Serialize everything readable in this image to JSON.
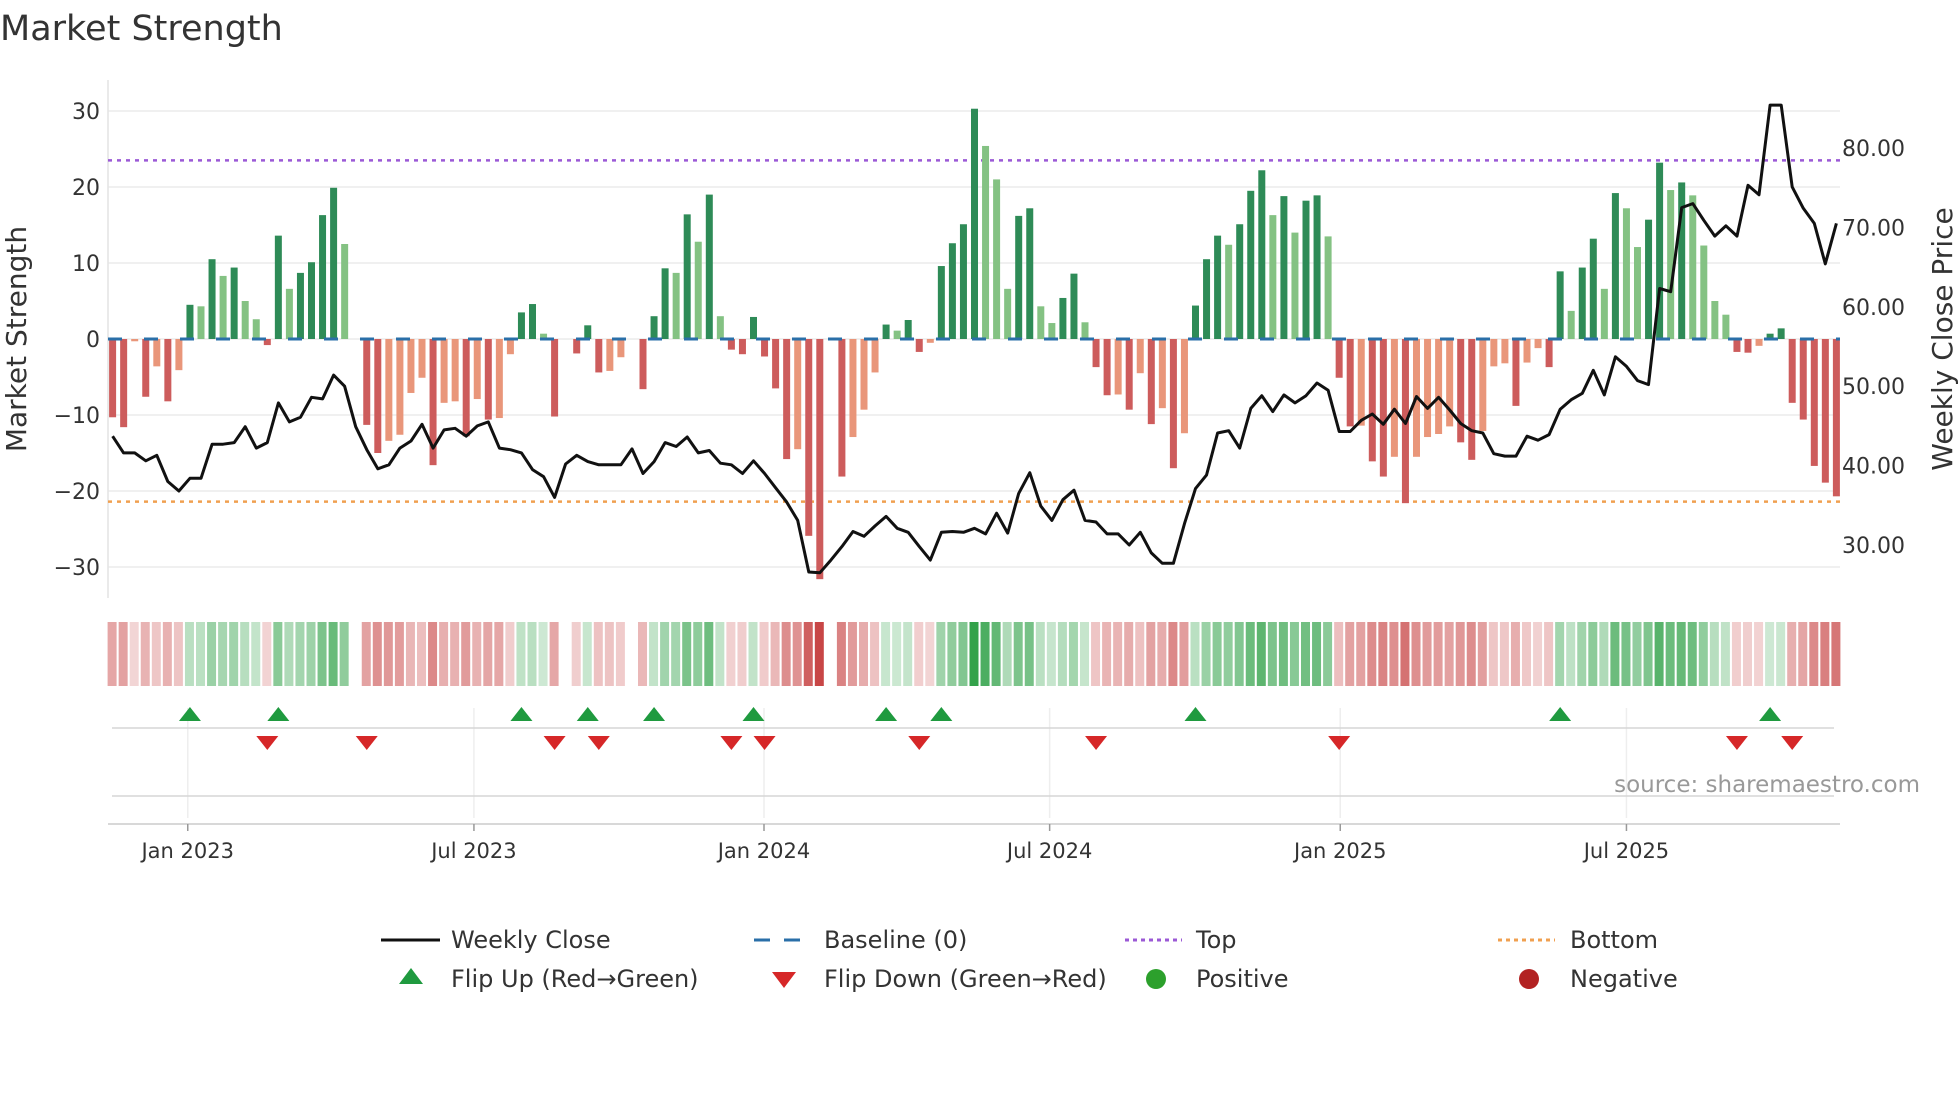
{
  "chart_data": {
    "type": "bar",
    "title": "Market Strength",
    "ylabel": "Market Strength",
    "y2label": "Weekly Close Price",
    "ylim": [
      -33.5,
      30.3
    ],
    "y2lim": [
      24.5,
      88
    ],
    "y_ticks": [
      30,
      20,
      10,
      0,
      -10,
      -20,
      -30
    ],
    "y_tick_labels": [
      "30",
      "20",
      "10",
      "0",
      "−10",
      "−20",
      "−30"
    ],
    "y2_ticks": [
      80,
      70,
      60,
      50,
      40,
      30
    ],
    "y2_tick_labels": [
      "80.00",
      "70.00",
      "60.00",
      "50.00",
      "40.00",
      "30.00"
    ],
    "x_ticks": [
      {
        "label": "Jan 2023",
        "week_index": 6.8
      },
      {
        "label": "Jul 2023",
        "week_index": 32.7
      },
      {
        "label": "Jan 2024",
        "week_index": 58.95
      },
      {
        "label": "Jul 2024",
        "week_index": 84.8
      },
      {
        "label": "Jan 2025",
        "week_index": 111.1
      },
      {
        "label": "Jul 2025",
        "week_index": 137.0
      }
    ],
    "top_level": 23.5,
    "bottom_level": -21.4,
    "baseline": 0,
    "strength": [
      -10.3,
      -11.6,
      -0.3,
      -7.6,
      -3.6,
      -8.2,
      -4.1,
      4.5,
      4.3,
      10.5,
      8.3,
      9.4,
      5.0,
      2.6,
      -0.8,
      13.6,
      6.6,
      8.7,
      10.1,
      16.3,
      19.9,
      12.5,
      0,
      -11.3,
      -15.0,
      -13.4,
      -12.6,
      -7.1,
      -5.1,
      -16.6,
      -8.4,
      -8.2,
      -12.8,
      -7.9,
      -10.6,
      -10.4,
      -2.0,
      3.5,
      4.6,
      0.7,
      -10.2,
      0,
      -1.9,
      1.8,
      -4.4,
      -4.2,
      -2.4,
      0,
      -6.6,
      3.0,
      9.3,
      8.7,
      16.4,
      12.8,
      19.0,
      3.0,
      -1.4,
      -2.0,
      2.9,
      -2.3,
      -6.5,
      -15.8,
      -14.5,
      -25.9,
      -31.6,
      0,
      -18.1,
      -12.9,
      -9.3,
      -4.4,
      1.9,
      1.1,
      2.5,
      -1.7,
      -0.5,
      9.6,
      12.6,
      15.1,
      30.3,
      25.4,
      21.0,
      6.6,
      16.2,
      17.2,
      4.3,
      2.1,
      5.4,
      8.6,
      2.2,
      -3.7,
      -7.4,
      -7.3,
      -9.3,
      -4.5,
      -11.2,
      -9.1,
      -17.0,
      -12.4,
      4.4,
      10.5,
      13.6,
      12.4,
      15.1,
      19.5,
      22.2,
      16.3,
      18.8,
      14.0,
      18.2,
      18.9,
      13.5,
      -5.1,
      -11.5,
      -11.4,
      -16.1,
      -18.1,
      -15.5,
      -21.6,
      -15.5,
      -12.9,
      -12.5,
      -11.5,
      -13.6,
      -15.9,
      -12.1,
      -3.6,
      -3.2,
      -8.8,
      -3.1,
      -1.2,
      -3.7,
      8.9,
      3.7,
      9.4,
      13.2,
      6.6,
      19.2,
      17.2,
      12.1,
      15.7,
      23.2,
      19.6,
      20.6,
      18.9,
      12.3,
      5.0,
      3.2,
      -1.7,
      -1.8,
      -0.9,
      0.7,
      1.4,
      -8.4,
      -10.6,
      -16.7,
      -18.9,
      -20.7
    ],
    "weekly_close": [
      43.7,
      41.6,
      41.6,
      40.6,
      41.3,
      38.0,
      36.8,
      38.4,
      38.4,
      42.7,
      42.7,
      42.9,
      44.9,
      42.2,
      42.9,
      47.9,
      45.5,
      46.1,
      48.6,
      48.4,
      51.4,
      50.0,
      44.9,
      42.0,
      39.6,
      40.1,
      42.2,
      43.1,
      45.2,
      42.2,
      44.5,
      44.7,
      43.7,
      45.0,
      45.5,
      42.2,
      42.0,
      41.6,
      39.5,
      38.6,
      36.0,
      40.2,
      41.3,
      40.5,
      40.1,
      40.1,
      40.1,
      42.1,
      39.0,
      40.5,
      42.9,
      42.4,
      43.6,
      41.6,
      41.9,
      40.3,
      40.1,
      39.0,
      40.6,
      39.0,
      37.2,
      35.4,
      33.1,
      26.6,
      26.5,
      28.1,
      29.8,
      31.7,
      31.1,
      32.4,
      33.6,
      32.1,
      31.6,
      29.8,
      28.1,
      31.6,
      31.7,
      31.6,
      32.1,
      31.4,
      34.0,
      31.5,
      36.5,
      39.1,
      34.9,
      33.1,
      35.7,
      36.9,
      33.1,
      32.9,
      31.4,
      31.4,
      30.0,
      31.6,
      29.0,
      27.7,
      27.7,
      32.7,
      37.1,
      38.8,
      44.1,
      44.4,
      42.2,
      47.2,
      48.8,
      46.8,
      48.9,
      47.9,
      48.8,
      50.4,
      49.5,
      44.3,
      44.3,
      45.7,
      46.5,
      45.2,
      47.1,
      45.3,
      48.7,
      47.2,
      48.6,
      47.0,
      45.3,
      44.4,
      44.1,
      41.5,
      41.2,
      41.2,
      43.7,
      43.2,
      43.9,
      47.1,
      48.3,
      49.1,
      52.0,
      48.9,
      53.7,
      52.5,
      50.7,
      50.2,
      62.3,
      61.9,
      72.5,
      73.0,
      70.9,
      68.9,
      70.2,
      68.9,
      75.3,
      74.1,
      85.4,
      85.4,
      75.1,
      72.4,
      70.5,
      65.4,
      70.5
    ],
    "flip_up_index": [
      7,
      15,
      37,
      43,
      49,
      58,
      70,
      75,
      98,
      131,
      150
    ],
    "flip_down_index": [
      14,
      23,
      40,
      44,
      56,
      59,
      73,
      89,
      111,
      147,
      152
    ],
    "legend": {
      "position": "bottom",
      "items": [
        {
          "label": "Weekly Close",
          "kind": "line"
        },
        {
          "label": "Baseline (0)",
          "kind": "dash"
        },
        {
          "label": "Top",
          "kind": "dotted-top"
        },
        {
          "label": "Bottom",
          "kind": "dotted-bottom"
        },
        {
          "label": "Flip Up (Red→Green)",
          "kind": "triangle-up"
        },
        {
          "label": "Flip Down (Green→Red)",
          "kind": "triangle-down"
        },
        {
          "label": "Positive",
          "kind": "circle-pos"
        },
        {
          "label": "Negative",
          "kind": "circle-neg"
        }
      ]
    },
    "grid": true
  },
  "source": "source: sharemaestro.com",
  "colors": {
    "pos_rising": "#2e8b57",
    "pos_falling": "#84c283",
    "neg_falling": "#cd5c5c",
    "neg_rising": "#e9967a",
    "line": "#111111",
    "baseline": "#2a6fa8",
    "top": "#9b59d6",
    "bottom": "#f0a050",
    "flip_up": "#1f9a3f",
    "flip_down": "#d62728",
    "positive": "#2ca02c",
    "negative": "#b22222",
    "grid": "#ececec"
  }
}
